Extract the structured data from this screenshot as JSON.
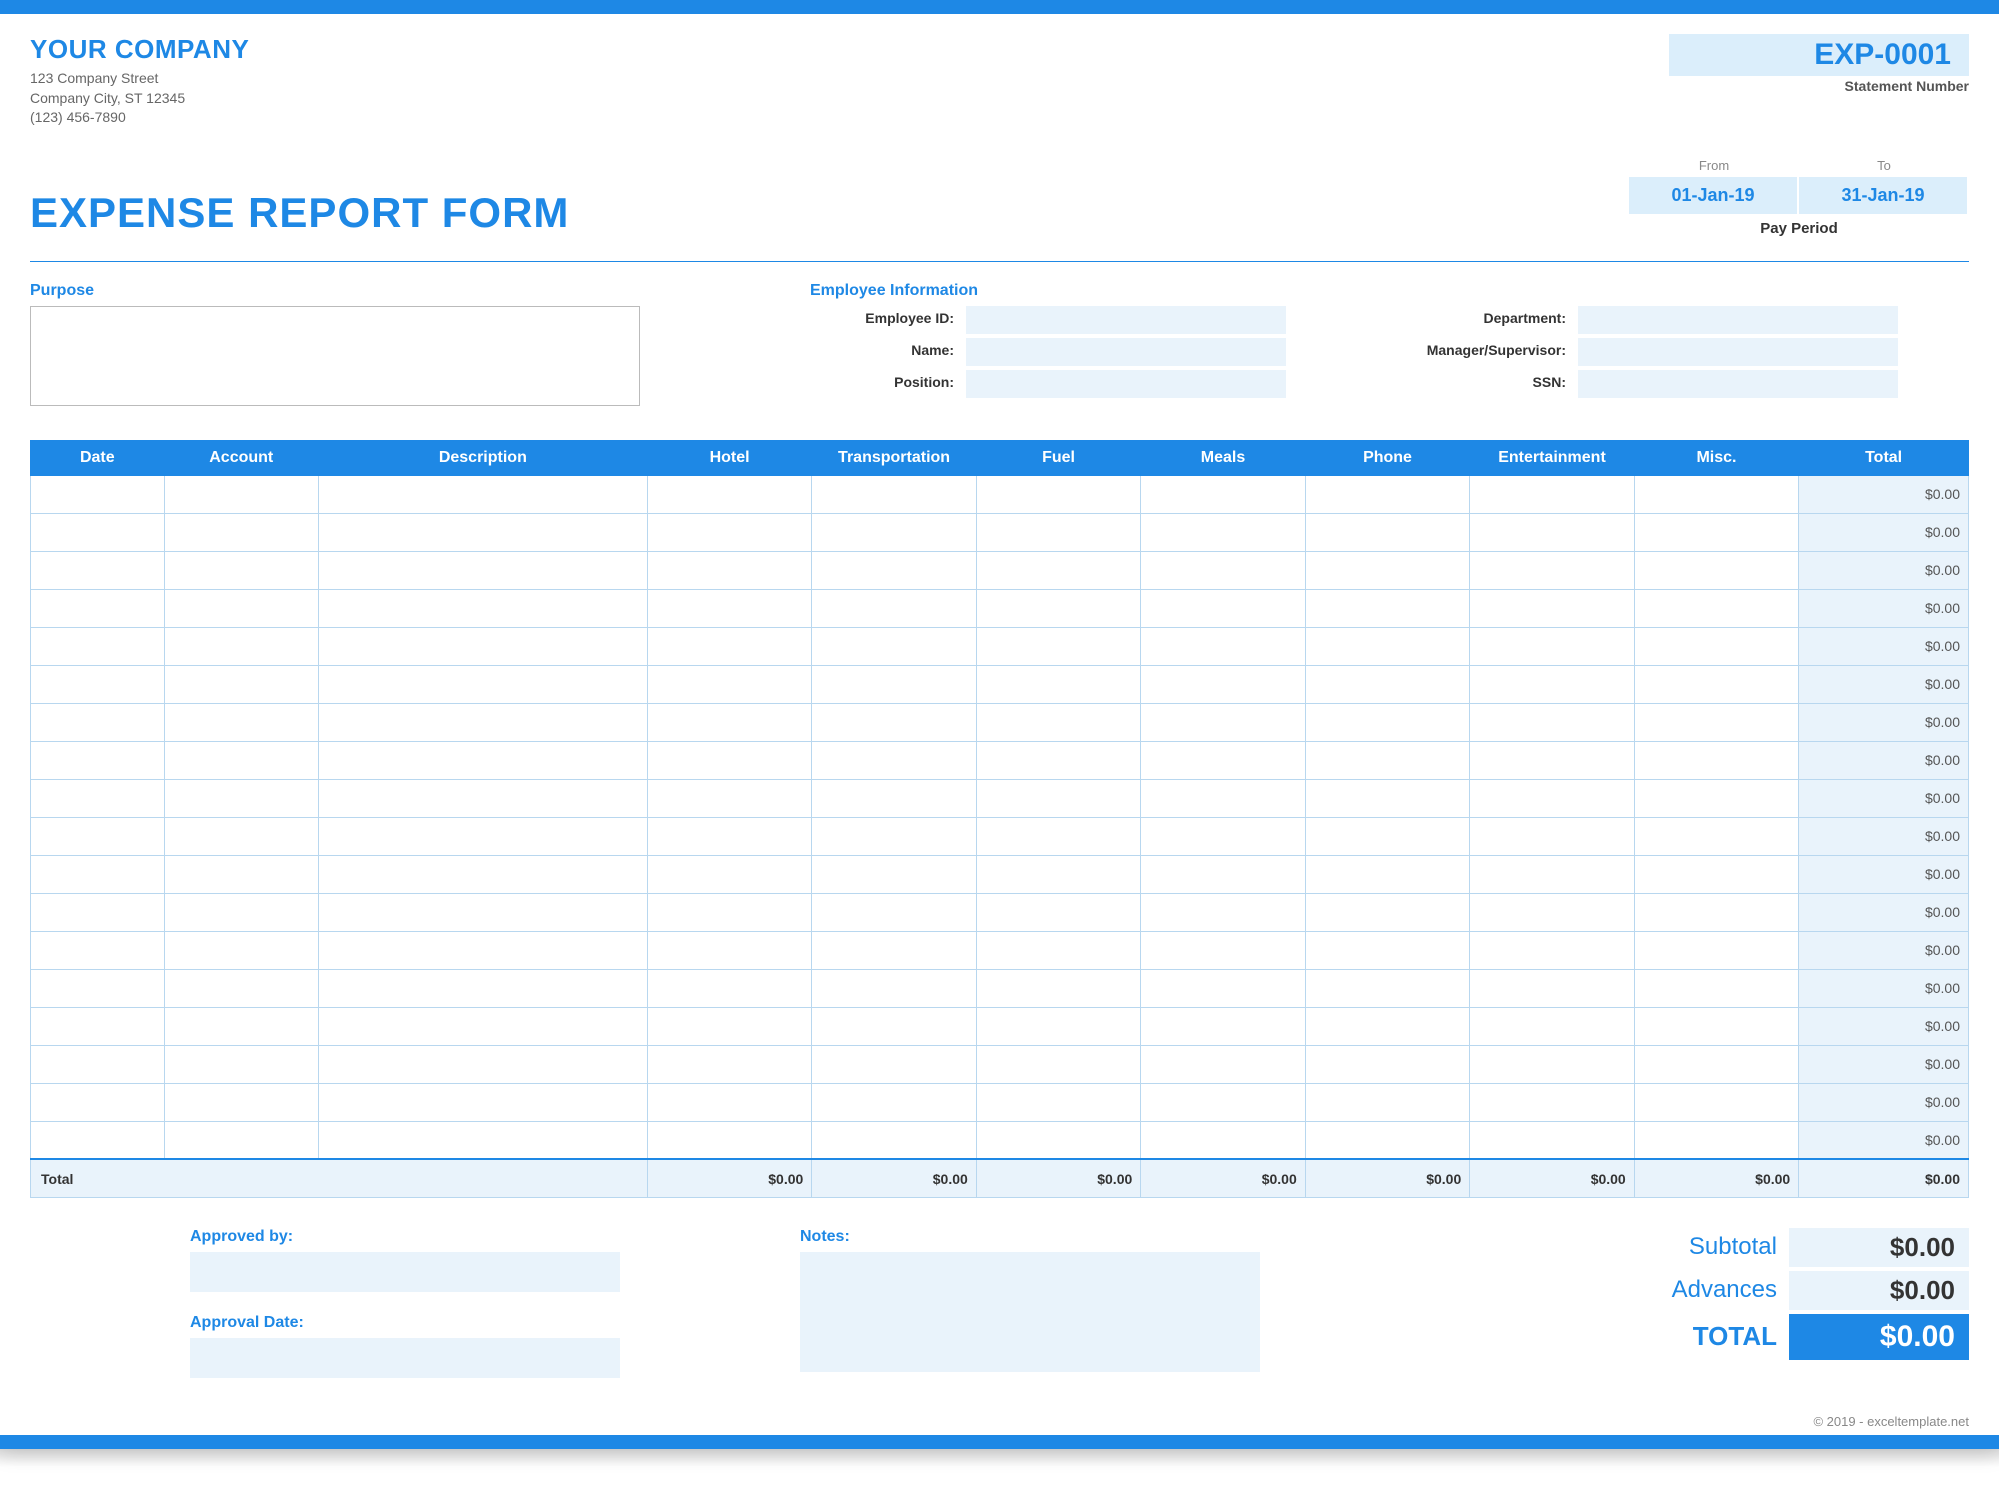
{
  "company": {
    "name": "YOUR COMPANY",
    "addr1": "123 Company Street",
    "addr2": "Company City, ST 12345",
    "phone": "(123) 456-7890"
  },
  "statement": {
    "number": "EXP-0001",
    "label": "Statement Number"
  },
  "form": {
    "title": "EXPENSE REPORT FORM"
  },
  "period": {
    "from_label": "From",
    "to_label": "To",
    "from": "01-Jan-19",
    "to": "31-Jan-19",
    "label": "Pay Period"
  },
  "purpose": {
    "label": "Purpose",
    "value": ""
  },
  "employee": {
    "section_label": "Employee Information",
    "id_label": "Employee ID:",
    "id": "",
    "name_label": "Name:",
    "name": "",
    "position_label": "Position:",
    "position": "",
    "dept_label": "Department:",
    "dept": "",
    "mgr_label": "Manager/Supervisor:",
    "mgr": "",
    "ssn_label": "SSN:",
    "ssn": ""
  },
  "table": {
    "headers": {
      "date": "Date",
      "account": "Account",
      "description": "Description",
      "hotel": "Hotel",
      "transportation": "Transportation",
      "fuel": "Fuel",
      "meals": "Meals",
      "phone": "Phone",
      "entertainment": "Entertainment",
      "misc": "Misc.",
      "total": "Total"
    },
    "row_total": "$0.00",
    "totals_label": "Total",
    "col_totals": {
      "hotel": "$0.00",
      "transportation": "$0.00",
      "fuel": "$0.00",
      "meals": "$0.00",
      "phone": "$0.00",
      "entertainment": "$0.00",
      "misc": "$0.00",
      "grand": "$0.00"
    }
  },
  "footer": {
    "approved_label": "Approved by:",
    "approved": "",
    "approval_date_label": "Approval Date:",
    "approval_date": "",
    "notes_label": "Notes:",
    "notes": ""
  },
  "summary": {
    "subtotal_label": "Subtotal",
    "subtotal": "$0.00",
    "advances_label": "Advances",
    "advances": "$0.00",
    "total_label": "TOTAL",
    "total": "$0.00"
  },
  "copyright": "© 2019 - exceltemplate.net"
}
